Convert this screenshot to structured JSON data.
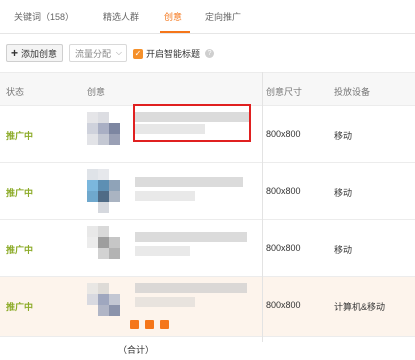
{
  "tabs": [
    {
      "label": "关键词（158）"
    },
    {
      "label": "精选人群"
    },
    {
      "label": "创意"
    },
    {
      "label": "定向推广"
    }
  ],
  "toolbar": {
    "add_label": "添加创意",
    "flow_select": "流量分配",
    "smart_title_label": "开启智能标题",
    "smart_title_checked": true
  },
  "table": {
    "headers": [
      "状态",
      "创意",
      "创意尺寸",
      "投放设备"
    ],
    "rows": [
      {
        "status": "推广中",
        "size": "800x800",
        "device": "移动"
      },
      {
        "status": "推广中",
        "size": "800x800",
        "device": "移动"
      },
      {
        "status": "推广中",
        "size": "800x800",
        "device": "移动"
      },
      {
        "status": "推广中",
        "size": "800x800",
        "device": "计算机&移动"
      }
    ]
  },
  "footer": {
    "total": "（合计）"
  },
  "colors": {
    "accent": "#f5761a",
    "status_green": "#8cab28",
    "highlight_red": "#e02020"
  }
}
